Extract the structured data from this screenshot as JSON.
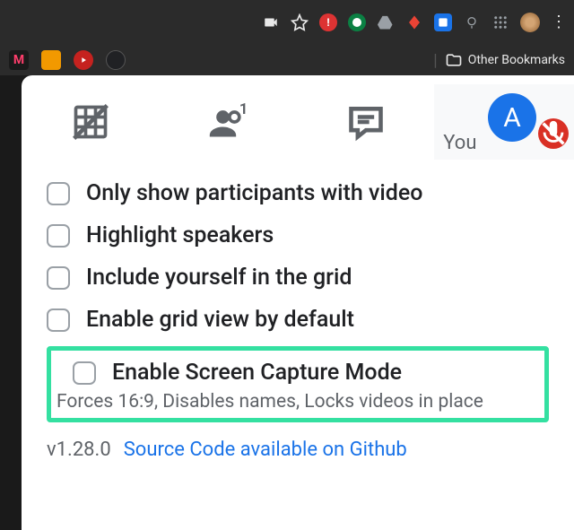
{
  "browser": {
    "bookmarks_label": "Other Bookmarks"
  },
  "you_tile": {
    "label": "You",
    "avatar_letter": "A"
  },
  "options": [
    {
      "label": "Only show participants with video",
      "checked": false
    },
    {
      "label": "Highlight speakers",
      "checked": false
    },
    {
      "label": "Include yourself in the grid",
      "checked": false
    },
    {
      "label": "Enable grid view by default",
      "checked": false
    }
  ],
  "highlighted_option": {
    "label": "Enable Screen Capture Mode",
    "subtitle": "Forces 16:9, Disables names, Locks videos in place",
    "checked": false
  },
  "footer": {
    "version": "v1.28.0",
    "source_link": "Source Code available on Github"
  }
}
